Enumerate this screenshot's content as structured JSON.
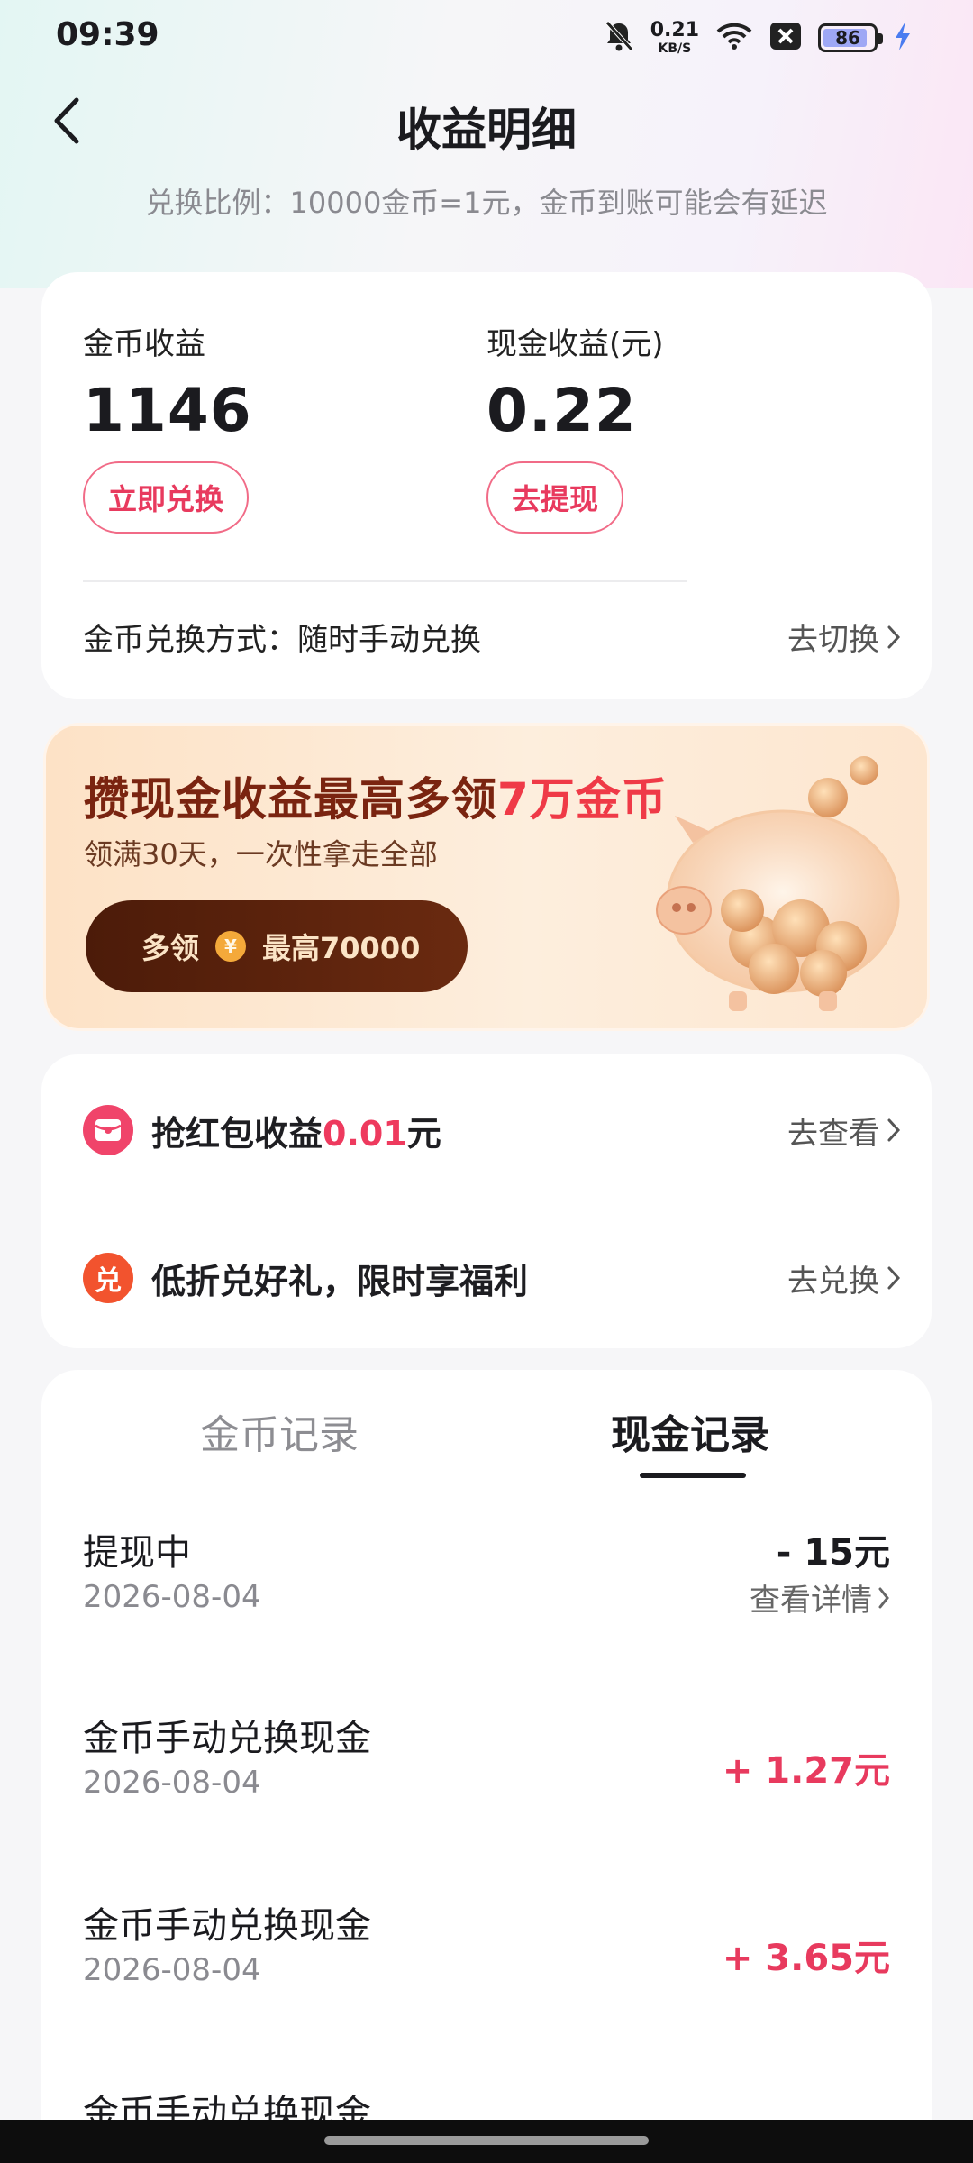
{
  "status": {
    "time": "09:39",
    "net_speed": "0.21",
    "net_unit": "KB/S",
    "battery": "86"
  },
  "header": {
    "title": "收益明细",
    "ratio_note": "兑换比例：10000金币=1元，金币到账可能会有延迟"
  },
  "earnings": {
    "coin_label": "金币收益",
    "coin_value": "1146",
    "coin_button": "立即兑换",
    "cash_label": "现金收益(元)",
    "cash_value": "0.22",
    "cash_button": "去提现",
    "mode_label": "金币兑换方式：随时手动兑换",
    "switch_label": "去切换"
  },
  "promo": {
    "title_main": "攒现金收益最高多领",
    "title_highlight": "7万金币",
    "subtitle": "领满30天，一次性拿走全部",
    "button_prefix": "多领",
    "coin_symbol": "¥",
    "button_suffix": "最高70000"
  },
  "links": [
    {
      "text_main": "抢红包收益",
      "text_red": "0.01",
      "text_tail": "元",
      "action": "去查看",
      "icon": "red-envelope-icon"
    },
    {
      "text_main": "低折兑好礼，限时享福利",
      "icon_text": "兑",
      "action": "去兑换",
      "icon": "exchange-icon"
    }
  ],
  "records": {
    "tabs": [
      "金币记录",
      "现金记录"
    ],
    "active_tab": "现金记录",
    "items": [
      {
        "title": "提现中",
        "date": "2026-08-04",
        "amount": "- 15元",
        "detail": "查看详情"
      },
      {
        "title": "金币手动兑换现金",
        "date": "2026-08-04",
        "amount": "+ 1.27元"
      },
      {
        "title": "金币手动兑换现金",
        "date": "2026-08-04",
        "amount": "+ 3.65元"
      },
      {
        "title": "金币手动兑换现金",
        "date": "",
        "amount": ""
      }
    ]
  },
  "colors": {
    "accent_red": "#e83a5e",
    "promo_brown": "#4c1b09",
    "text_gray": "#8a8a90"
  }
}
